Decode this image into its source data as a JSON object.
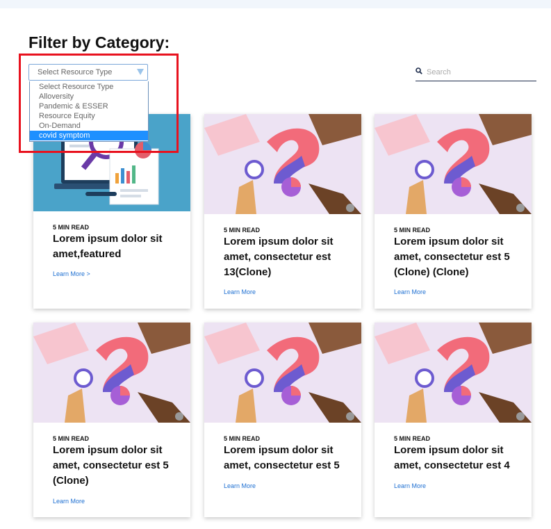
{
  "filter": {
    "heading": "Filter by Category:",
    "select_value": "Select Resource Type",
    "options": [
      {
        "label": "Select Resource Type",
        "selected": false
      },
      {
        "label": "Alloversity",
        "selected": false
      },
      {
        "label": "Pandemic & ESSER",
        "selected": false
      },
      {
        "label": "Resource Equity",
        "selected": false
      },
      {
        "label": "On-Demand",
        "selected": false
      },
      {
        "label": "covid symptom",
        "selected": true
      }
    ]
  },
  "search": {
    "placeholder": "Search",
    "icon": "search-icon"
  },
  "cards": [
    {
      "image": "laptop-analytics-illustration",
      "read_time": "5 MIN READ",
      "title": "Lorem ipsum dolor sit amet,featured",
      "link": "Learn More >"
    },
    {
      "image": "question-mark-hands-illustration",
      "read_time": "5 MIN READ",
      "title": "Lorem ipsum dolor sit amet, consectetur est 13(Clone)",
      "link": "Learn More"
    },
    {
      "image": "question-mark-hands-illustration",
      "read_time": "5 MIN READ",
      "title": "Lorem ipsum dolor sit amet, consectetur est 5 (Clone) (Clone)",
      "link": "Learn More"
    },
    {
      "image": "question-mark-hands-illustration",
      "read_time": "5 MIN READ",
      "title": "Lorem ipsum dolor sit amet, consectetur est 5 (Clone)",
      "link": "Learn More"
    },
    {
      "image": "question-mark-hands-illustration",
      "read_time": "5 MIN READ",
      "title": "Lorem ipsum dolor sit amet, consectetur est 5",
      "link": "Learn More"
    },
    {
      "image": "question-mark-hands-illustration",
      "read_time": "5 MIN READ",
      "title": "Lorem ipsum dolor sit amet, consectetur est 4",
      "link": "Learn More"
    }
  ],
  "colors": {
    "accent": "#1e90ff",
    "link": "#1d6fd1",
    "highlight": "#e8121e",
    "select_border": "#7aa7d9"
  }
}
